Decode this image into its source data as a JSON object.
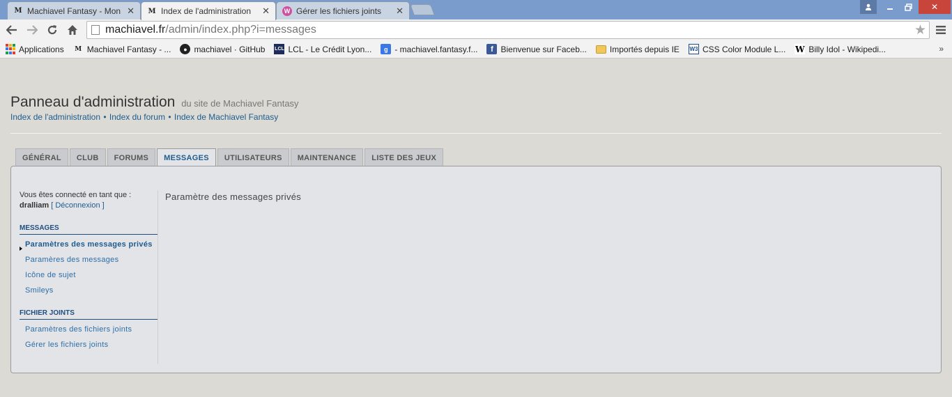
{
  "browser": {
    "tabs": [
      {
        "title": "Machiavel Fantasy - Mon",
        "active": false
      },
      {
        "title": "Index de l'administration",
        "active": true
      },
      {
        "title": "Gérer les fichiers joints",
        "active": false
      }
    ],
    "url_host": "machiavel.fr",
    "url_path": "/admin/index.php?i=messages",
    "bookmarks": [
      {
        "label": "Applications",
        "icon": "apps-grid-icon"
      },
      {
        "label": "Machiavel Fantasy - ...",
        "icon": "machiavel-icon"
      },
      {
        "label": "machiavel · GitHub",
        "icon": "github-icon"
      },
      {
        "label": "LCL - Le Crédit Lyon...",
        "icon": "lcl-icon"
      },
      {
        "label": "- machiavel.fantasy.f...",
        "icon": "google-icon"
      },
      {
        "label": "Bienvenue sur Faceb...",
        "icon": "facebook-icon"
      },
      {
        "label": "Importés depuis IE",
        "icon": "folder-icon"
      },
      {
        "label": "CSS Color Module L...",
        "icon": "w3c-icon"
      },
      {
        "label": "Billy Idol - Wikipedi...",
        "icon": "wikipedia-icon"
      }
    ],
    "bookmarks_more": "»"
  },
  "header": {
    "title": "Panneau d'administration",
    "subtitle": "du site de Machiavel Fantasy",
    "links": [
      "Index de l'administration",
      "Index du forum",
      "Index de Machiavel Fantasy"
    ],
    "link_separator": "•"
  },
  "tabs": [
    {
      "label": "GÉNÉRAL",
      "active": false
    },
    {
      "label": "CLUB",
      "active": false
    },
    {
      "label": "FORUMS",
      "active": false
    },
    {
      "label": "MESSAGES",
      "active": true
    },
    {
      "label": "UTILISATEURS",
      "active": false
    },
    {
      "label": "MAINTENANCE",
      "active": false
    },
    {
      "label": "LISTE DES JEUX",
      "active": false
    }
  ],
  "sidebar": {
    "login_text": "Vous êtes connecté en tant que :",
    "username": "dralliam",
    "logout": "[ Déconnexion ]",
    "sections": [
      {
        "heading": "MESSAGES",
        "items": [
          {
            "label": "Paramètres des messages privés",
            "active": true
          },
          {
            "label": "Paramères des messages",
            "active": false
          },
          {
            "label": "Icône de sujet",
            "active": false
          },
          {
            "label": "Smileys",
            "active": false
          }
        ]
      },
      {
        "heading": "FICHIER JOINTS",
        "items": [
          {
            "label": "Paramètres des fichiers joints",
            "active": false
          },
          {
            "label": "Gérer les fichiers joints",
            "active": false
          }
        ]
      }
    ]
  },
  "main": {
    "title": "Paramètre des messages privés"
  },
  "colors": {
    "page_bg": "#dcdad4",
    "panel_bg": "#e3e4e8",
    "link": "#1e5c8e",
    "tabstrip": "#7a9ccc"
  }
}
